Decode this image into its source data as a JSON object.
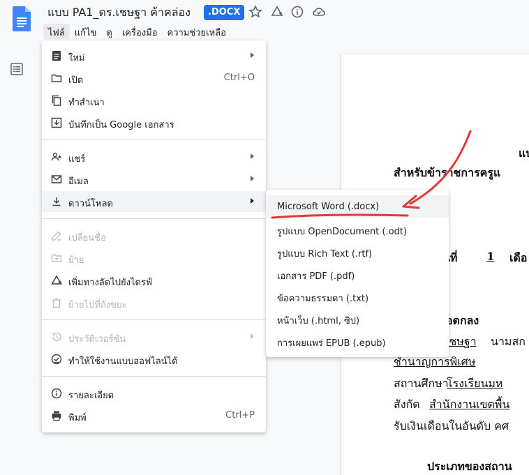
{
  "header": {
    "doc_title": "แบบ PA1_ดร.เชษฐา ค้าคล่อง",
    "badge": ".DOCX",
    "menus": [
      "ไฟล์",
      "แก้ไข",
      "ดู",
      "เครื่องมือ",
      "ความช่วยเหลือ"
    ]
  },
  "file_menu": {
    "items": [
      {
        "label": "ใหม่",
        "shortcut": "",
        "icon": "new-doc-icon",
        "submenu": true,
        "disabled": false
      },
      {
        "label": "เปิด",
        "shortcut": "Ctrl+O",
        "icon": "folder-icon",
        "submenu": false,
        "disabled": false
      },
      {
        "label": "ทำสำเนา",
        "shortcut": "",
        "icon": "copy-icon",
        "submenu": false,
        "disabled": false
      },
      {
        "label": "บันทึกเป็น Google เอกสาร",
        "shortcut": "",
        "icon": "save-as-icon",
        "submenu": false,
        "disabled": false
      },
      {
        "label": "แชร์",
        "shortcut": "",
        "icon": "share-icon",
        "submenu": true,
        "disabled": false
      },
      {
        "label": "อีเมล",
        "shortcut": "",
        "icon": "email-icon",
        "submenu": true,
        "disabled": false
      },
      {
        "label": "ดาวน์โหลด",
        "shortcut": "",
        "icon": "download-icon",
        "submenu": true,
        "disabled": false
      },
      {
        "label": "เปลี่ยนชื่อ",
        "shortcut": "",
        "icon": "rename-icon",
        "submenu": false,
        "disabled": true
      },
      {
        "label": "ย้าย",
        "shortcut": "",
        "icon": "move-icon",
        "submenu": false,
        "disabled": true
      },
      {
        "label": "เพิ่มทางลัดไปยังไดรฟ์",
        "shortcut": "",
        "icon": "drive-shortcut-icon",
        "submenu": false,
        "disabled": false
      },
      {
        "label": "ย้ายไปที่ถังขยะ",
        "shortcut": "",
        "icon": "trash-icon",
        "submenu": false,
        "disabled": true
      },
      {
        "label": "ประวัติเวอร์ชัน",
        "shortcut": "",
        "icon": "history-icon",
        "submenu": true,
        "disabled": true
      },
      {
        "label": "ทำให้ใช้งานแบบออฟไลน์ได้",
        "shortcut": "",
        "icon": "offline-icon",
        "submenu": false,
        "disabled": false
      },
      {
        "label": "รายละเอียด",
        "shortcut": "",
        "icon": "info-icon",
        "submenu": false,
        "disabled": false
      },
      {
        "label": "พิมพ์",
        "shortcut": "Ctrl+P",
        "icon": "print-icon",
        "submenu": false,
        "disabled": false
      }
    ]
  },
  "download_submenu": {
    "items": [
      "Microsoft Word (.docx)",
      "รูปแบบ OpenDocument (.odt)",
      "รูปแบบ Rich Text (.rtf)",
      "เอกสาร PDF (.pdf)",
      "ข้อความธรรมดา (.txt)",
      "หน้าเว็บ (.html, ซิป)",
      "การเผยแพร่ EPUB (.epub)"
    ]
  },
  "document": {
    "lines": [
      "แบ",
      "สำหรับข้าราชการครูแ",
      "วันที่",
      "1",
      "เดือ",
      "ข้อตกลง",
      "เชษฐา",
      "นามสก",
      "ชำนาญการพิเศษ",
      "สถานศึกษา",
      "โรงเรียนมห",
      "สังกัด",
      "สำนักงานเขตพื้น",
      "รับเงินเดือนในอันดับ คศ",
      "ประเภทของสถาน"
    ]
  },
  "colors": {
    "accent": "#1a73e8",
    "annotation": "#e53935"
  }
}
